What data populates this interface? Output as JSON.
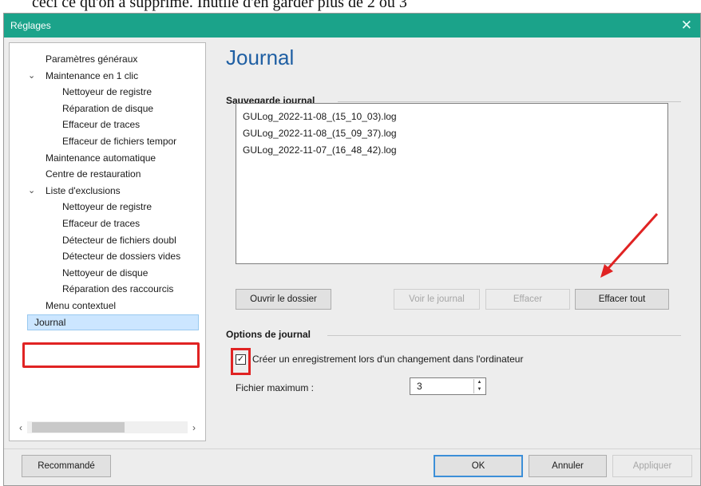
{
  "background_text": "ceci ce qu'on a supprimé. Inutile d'en garder plus de 2 ou 3",
  "window": {
    "title": "Réglages",
    "close_glyph": "✕"
  },
  "sidebar": {
    "items": [
      {
        "label": "Paramètres généraux",
        "level": 1
      },
      {
        "label": "Maintenance en 1 clic",
        "level": 1,
        "expanded": true
      },
      {
        "label": "Nettoyeur de registre",
        "level": 2
      },
      {
        "label": "Réparation de disque",
        "level": 2
      },
      {
        "label": "Effaceur de traces",
        "level": 2
      },
      {
        "label": "Effaceur de fichiers tempor",
        "level": 2
      },
      {
        "label": "Maintenance automatique",
        "level": 1
      },
      {
        "label": "Centre de restauration",
        "level": 1
      },
      {
        "label": "Liste d'exclusions",
        "level": 1,
        "expanded": true
      },
      {
        "label": "Nettoyeur de registre",
        "level": 2
      },
      {
        "label": "Effaceur de traces",
        "level": 2
      },
      {
        "label": "Détecteur de fichiers doubl",
        "level": 2
      },
      {
        "label": "Détecteur de dossiers vides",
        "level": 2
      },
      {
        "label": "Nettoyeur de disque",
        "level": 2
      },
      {
        "label": "Réparation des raccourcis",
        "level": 2
      },
      {
        "label": "Menu contextuel",
        "level": 1
      },
      {
        "label": "Journal",
        "level": 1,
        "selected": true
      }
    ],
    "scroll_left_glyph": "‹",
    "scroll_right_glyph": "›"
  },
  "main": {
    "title": "Journal",
    "backup_section": {
      "label": "Sauvegarde journal",
      "files": [
        "GULog_2022-11-08_(15_10_03).log",
        "GULog_2022-11-08_(15_09_37).log",
        "GULog_2022-11-07_(16_48_42).log"
      ],
      "buttons": {
        "open_folder": "Ouvrir le dossier",
        "view_log": "Voir le journal",
        "delete": "Effacer",
        "delete_all": "Effacer tout"
      }
    },
    "options_section": {
      "label": "Options de journal",
      "checkbox_label": "Créer un enregistrement lors d'un changement dans l'ordinateur",
      "checkbox_checked": true,
      "checkmark_glyph": "✓",
      "max_files_label": "Fichier maximum :",
      "max_files_value": "3"
    }
  },
  "footer": {
    "recommended": "Recommandé",
    "ok": "OK",
    "cancel": "Annuler",
    "apply": "Appliquer"
  },
  "colors": {
    "title_bar": "#1ba38a",
    "page_title": "#1f5fa3",
    "annotation": "#e02323",
    "selection": "#cce6ff"
  }
}
